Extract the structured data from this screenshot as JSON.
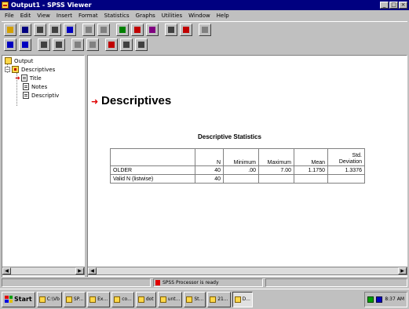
{
  "window": {
    "title": "Output1 - SPSS Viewer",
    "controls": [
      "_",
      "□",
      "×"
    ]
  },
  "menu": [
    "File",
    "Edit",
    "View",
    "Insert",
    "Format",
    "Statistics",
    "Graphs",
    "Utilities",
    "Window",
    "Help"
  ],
  "toolbar1": [
    {
      "icon": "open-folder-icon",
      "color": "#d4a000"
    },
    {
      "icon": "save-icon",
      "color": "#000080"
    },
    {
      "icon": "print-icon",
      "color": "#404040"
    },
    {
      "icon": "print-preview-icon",
      "color": "#404040"
    },
    {
      "icon": "export-icon",
      "color": "#0000c0"
    },
    {
      "icon": "dialog-recall-icon",
      "color": "#808080"
    },
    {
      "icon": "undo-icon",
      "color": "#808080"
    },
    {
      "icon": "goto-chart-icon",
      "color": "#008000"
    },
    {
      "icon": "goto-data-icon",
      "color": "#c00000"
    },
    {
      "icon": "goto-case-icon",
      "color": "#800080"
    },
    {
      "icon": "find-icon",
      "color": "#404040"
    },
    {
      "icon": "designate-window-icon",
      "color": "#c00000"
    },
    {
      "icon": "help-icon",
      "color": "#808080"
    }
  ],
  "toolbar2": [
    {
      "icon": "promote-icon",
      "color": "#0000c0"
    },
    {
      "icon": "demote-icon",
      "color": "#0000c0"
    },
    {
      "icon": "expand-icon",
      "color": "#404040"
    },
    {
      "icon": "collapse-icon",
      "color": "#404040"
    },
    {
      "icon": "show-icon",
      "color": "#808080"
    },
    {
      "icon": "hide-icon",
      "color": "#808080"
    },
    {
      "icon": "insert-heading-icon",
      "color": "#c00000"
    },
    {
      "icon": "insert-title-icon",
      "color": "#404040"
    },
    {
      "icon": "insert-text-icon",
      "color": "#404040"
    }
  ],
  "outline": {
    "root": "Output",
    "group": "Descriptives",
    "items": [
      "Title",
      "Notes",
      "Descriptiv"
    ]
  },
  "content": {
    "heading": "Descriptives",
    "table_title": "Descriptive Statistics",
    "columns": [
      "N",
      "Minimum",
      "Maximum",
      "Mean",
      "Std. Deviation"
    ],
    "rows": [
      {
        "label": "OLDER",
        "values": [
          "40",
          ".00",
          "7.00",
          "1.1750",
          "1.3376"
        ]
      },
      {
        "label": "Valid N (listwise)",
        "values": [
          "40",
          "",
          "",
          "",
          ""
        ]
      }
    ]
  },
  "status": {
    "message": "SPSS Processor is ready"
  },
  "taskbar": {
    "start": "Start",
    "buttons": [
      "C:\\Vb",
      "SP...",
      "Ex...",
      "co...",
      "dot",
      "unt...",
      "St...",
      "21...",
      "D..."
    ],
    "active_index": 8,
    "clock": "8:37 AM"
  },
  "colors": {
    "title_bar": "#000080",
    "arrow_red": "#e00000",
    "face": "#c0c0c0"
  }
}
